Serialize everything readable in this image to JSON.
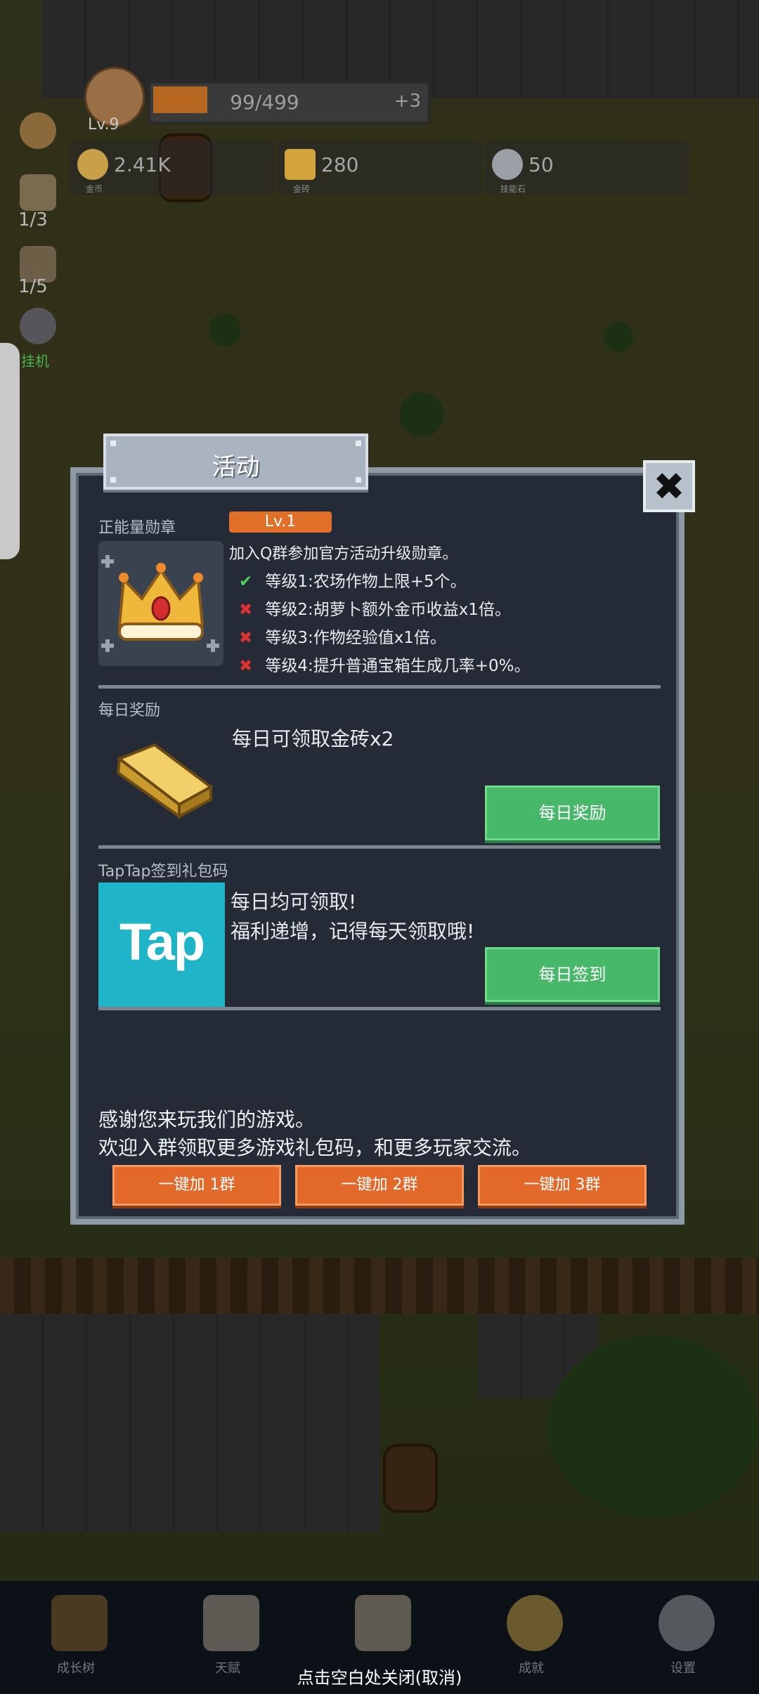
{
  "hud": {
    "level": "Lv.9",
    "xp_text": "99/499",
    "xp_fraction": 0.198,
    "xp_bonus": "+3",
    "resources": [
      {
        "icon": "gold-coin-icon",
        "value": "2.41K",
        "label": "金币"
      },
      {
        "icon": "gold-brick-icon",
        "value": "280",
        "label": "金砖"
      },
      {
        "icon": "skill-stone-icon",
        "value": "50",
        "label": "技能石"
      }
    ],
    "side_counters": [
      "1/3",
      "1/5"
    ],
    "side_label": "挂机"
  },
  "dialog": {
    "title": "活动",
    "close_icon": "close-icon",
    "medal": {
      "section_title": "正能量勋章",
      "level_badge": "Lv.1",
      "description": "加入Q群参加官方活动升级勋章。",
      "levels": [
        {
          "status": "done",
          "text": "等级1:农场作物上限+5个。"
        },
        {
          "status": "locked",
          "text": "等级2:胡萝卜额外金币收益x1倍。"
        },
        {
          "status": "locked",
          "text": "等级3:作物经验值x1倍。"
        },
        {
          "status": "locked",
          "text": "等级4:提升普通宝箱生成几率+0%。"
        }
      ]
    },
    "daily": {
      "section_title": "每日奖励",
      "text": "每日可领取金砖x2",
      "button": "每日奖励"
    },
    "taptap": {
      "section_title": "TapTap签到礼包码",
      "logo_text": "Tap",
      "line1": "每日均可领取!",
      "line2": "福利递增，记得每天领取哦!",
      "button": "每日签到"
    },
    "footer": {
      "line1": "感谢您来玩我们的游戏。",
      "line2": "欢迎入群领取更多游戏礼包码，和更多玩家交流。",
      "buttons": [
        "一键加 1群",
        "一键加 2群",
        "一键加 3群"
      ]
    }
  },
  "nav": {
    "items": [
      {
        "label": "成长树",
        "icon": "book-icon"
      },
      {
        "label": "天赋",
        "icon": "scroll-icon"
      },
      {
        "label": "",
        "icon": "map-icon"
      },
      {
        "label": "成就",
        "icon": "key-icon"
      },
      {
        "label": "设置",
        "icon": "gear-icon"
      }
    ],
    "close_hint": "点击空白处关闭(取消)"
  }
}
